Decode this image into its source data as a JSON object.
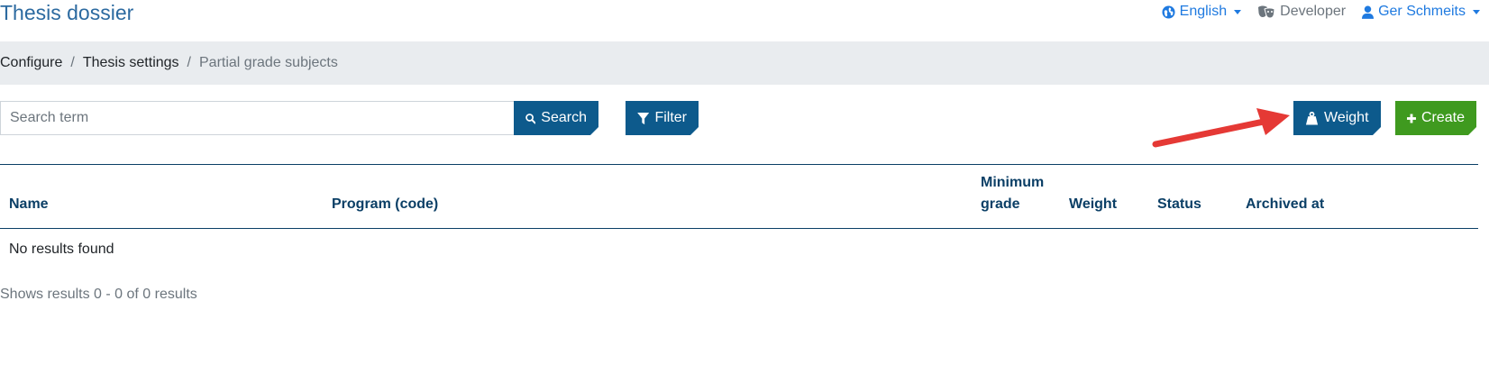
{
  "app": {
    "title": "Thesis dossier"
  },
  "topnav": {
    "language": {
      "label": "English",
      "icon": "globe-icon"
    },
    "role": {
      "label": "Developer",
      "icon": "masks-icon"
    },
    "user": {
      "label": "Ger Schmeits",
      "icon": "user-icon"
    }
  },
  "breadcrumb": {
    "items": [
      "Configure",
      "Thesis settings",
      "Partial grade subjects"
    ],
    "separator": "/"
  },
  "search": {
    "placeholder": "Search term",
    "value": "",
    "button_label": "Search"
  },
  "toolbar": {
    "filter_label": "Filter",
    "weight_label": "Weight",
    "create_label": "Create"
  },
  "table": {
    "columns": [
      "Name",
      "Program (code)",
      "Minimum grade",
      "Weight",
      "Status",
      "Archived at"
    ],
    "empty_text": "No results found"
  },
  "pagination": {
    "summary": "Shows results 0 - 0 of 0 results"
  },
  "colors": {
    "primary": "#0d5a8c",
    "success": "#3f9a1f",
    "link": "#1f7ae0",
    "title": "#2c6aa0",
    "annotation_arrow": "#e53935"
  }
}
